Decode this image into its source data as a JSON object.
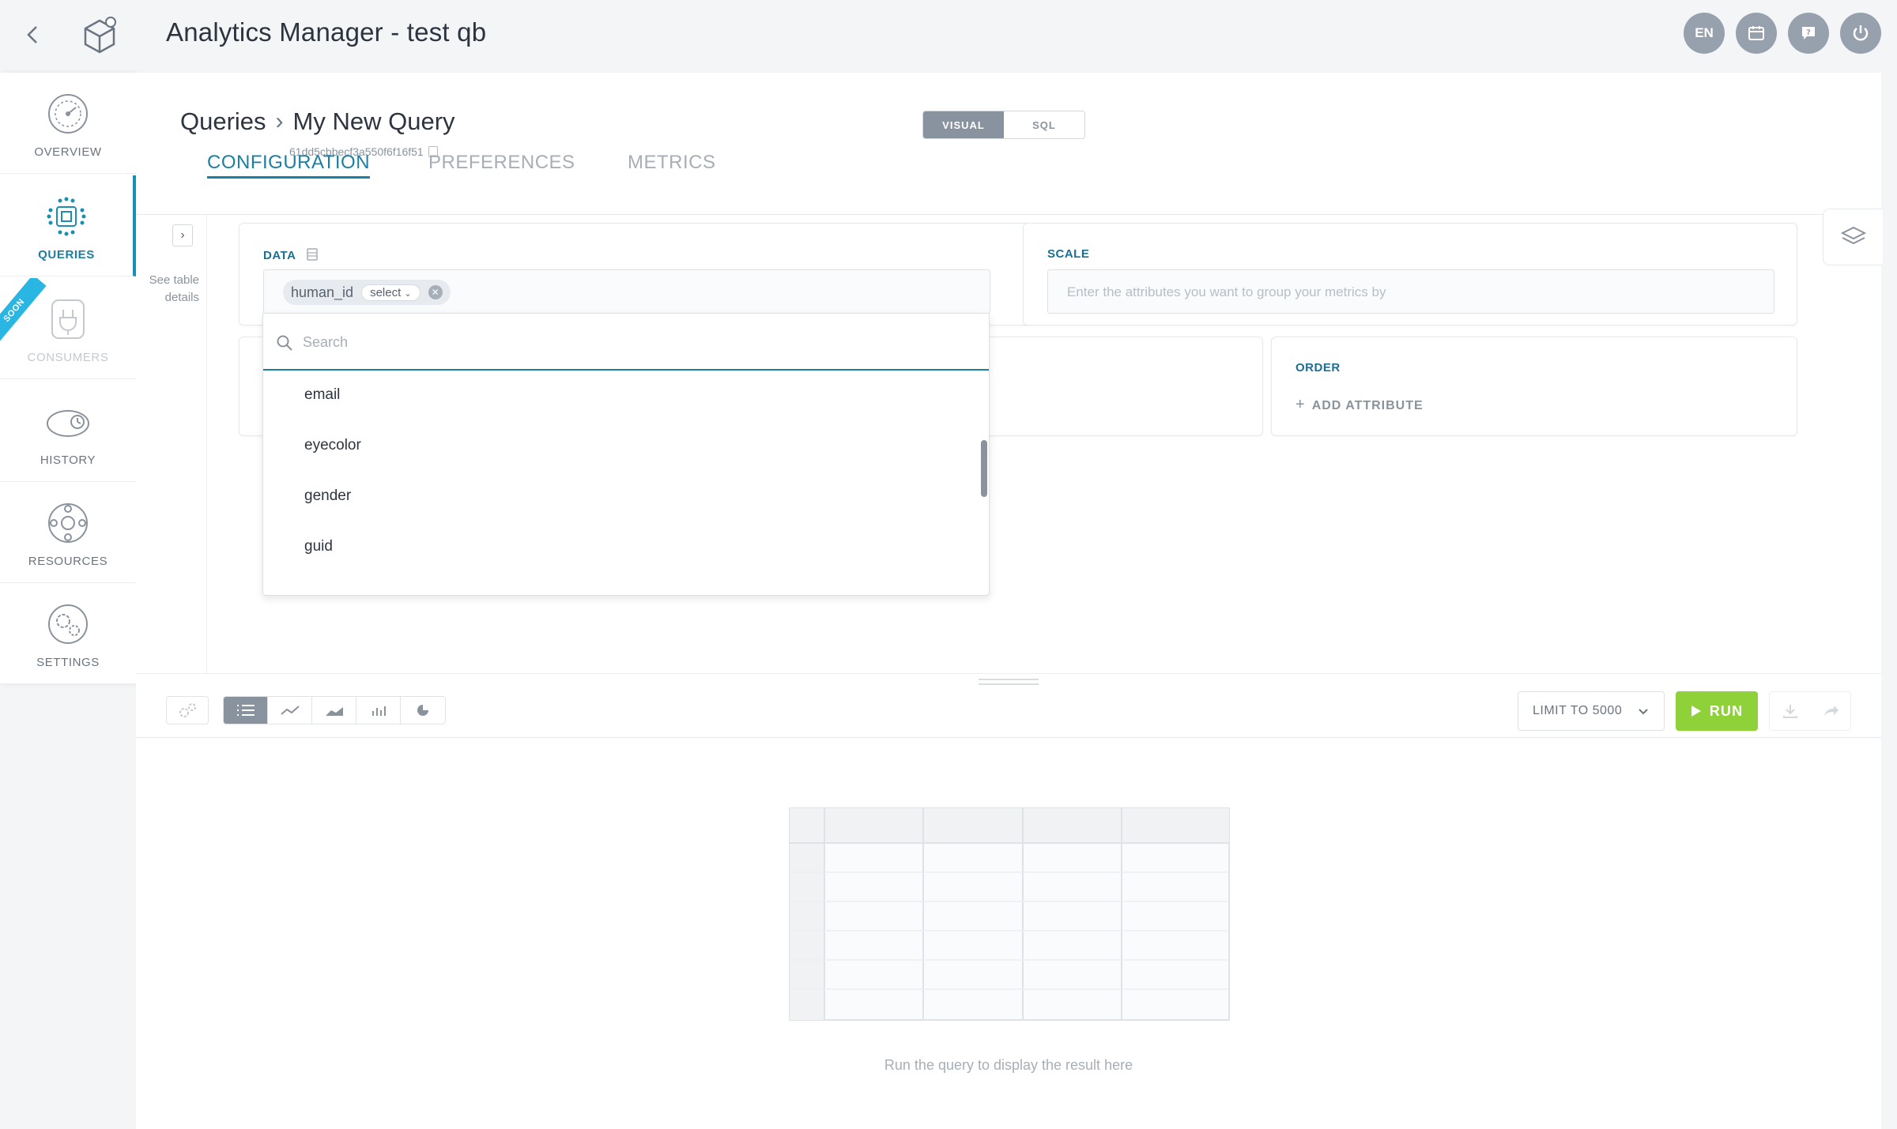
{
  "app": {
    "title": "Analytics Manager - test qb"
  },
  "header": {
    "buttons": [
      {
        "name": "language-button",
        "label": "EN"
      },
      {
        "name": "calendar-icon",
        "label": ""
      },
      {
        "name": "help-icon",
        "label": ""
      },
      {
        "name": "power-icon",
        "label": ""
      }
    ]
  },
  "sidebar": {
    "items": [
      {
        "label": "OVERVIEW",
        "icon": "dashboard-gauge-icon"
      },
      {
        "label": "QUERIES",
        "icon": "queries-chip-icon",
        "active": true
      },
      {
        "label": "CONSUMERS",
        "icon": "plug-icon",
        "disabled": true,
        "ribbon": "SOON"
      },
      {
        "label": "HISTORY",
        "icon": "history-icon"
      },
      {
        "label": "RESOURCES",
        "icon": "resources-icon"
      },
      {
        "label": "SETTINGS",
        "icon": "settings-gear-icon"
      }
    ]
  },
  "page": {
    "breadcrumb_root": "Queries",
    "breadcrumb_current": "My New Query",
    "query_id": "61dd5cbbecf3a550f6f16f51",
    "mode_visual": "VISUAL",
    "mode_sql": "SQL"
  },
  "tabs": [
    {
      "label": "CONFIGURATION",
      "active": true
    },
    {
      "label": "PREFERENCES"
    },
    {
      "label": "METRICS"
    }
  ],
  "left_strip": {
    "see_details": "See table details"
  },
  "data_card": {
    "title": "DATA",
    "chip_label": "human_id",
    "chip_select": "select"
  },
  "scale_card": {
    "title": "SCALE",
    "placeholder": "Enter the attributes you want to group your metrics by"
  },
  "order_card": {
    "title": "ORDER",
    "add_label": "ADD ATTRIBUTE"
  },
  "dropdown": {
    "search_placeholder": "Search",
    "items": [
      "email",
      "eyecolor",
      "gender",
      "guid"
    ]
  },
  "toolbar": {
    "limit_label": "LIMIT TO 5000",
    "run_label": "RUN"
  },
  "results": {
    "empty_message": "Run the query to display the result here"
  },
  "colors": {
    "accent": "#1a7fa3",
    "run_green": "#8ed138",
    "header_button": "#97a1ad"
  }
}
